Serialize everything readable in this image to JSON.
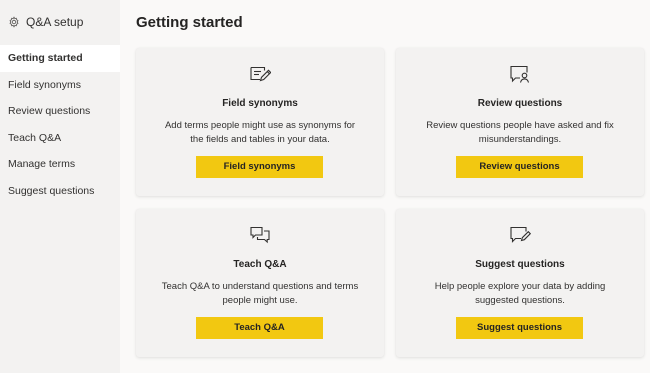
{
  "sidebar": {
    "title": "Q&A setup",
    "header_icon": "gear-icon",
    "items": [
      {
        "label": "Getting started",
        "active": true
      },
      {
        "label": "Field synonyms",
        "active": false
      },
      {
        "label": "Review questions",
        "active": false
      },
      {
        "label": "Teach Q&A",
        "active": false
      },
      {
        "label": "Manage terms",
        "active": false
      },
      {
        "label": "Suggest questions",
        "active": false
      }
    ]
  },
  "main": {
    "title": "Getting started",
    "cards": [
      {
        "icon": "edit-document-icon",
        "title": "Field synonyms",
        "description": "Add terms people might use as synonyms for the fields and tables in your data.",
        "button": "Field synonyms"
      },
      {
        "icon": "review-user-icon",
        "title": "Review questions",
        "description": "Review questions people have asked and fix misunderstandings.",
        "button": "Review questions"
      },
      {
        "icon": "chat-bubbles-icon",
        "title": "Teach Q&A",
        "description": "Teach Q&A to understand questions and terms people might use.",
        "button": "Teach Q&A"
      },
      {
        "icon": "comment-edit-icon",
        "title": "Suggest questions",
        "description": "Help people explore your data by adding suggested questions.",
        "button": "Suggest questions"
      }
    ]
  },
  "colors": {
    "accent": "#f2c811",
    "sidebar_bg": "#f3f2f1",
    "main_bg": "#faf9f8",
    "card_bg": "#f3f2f1"
  }
}
